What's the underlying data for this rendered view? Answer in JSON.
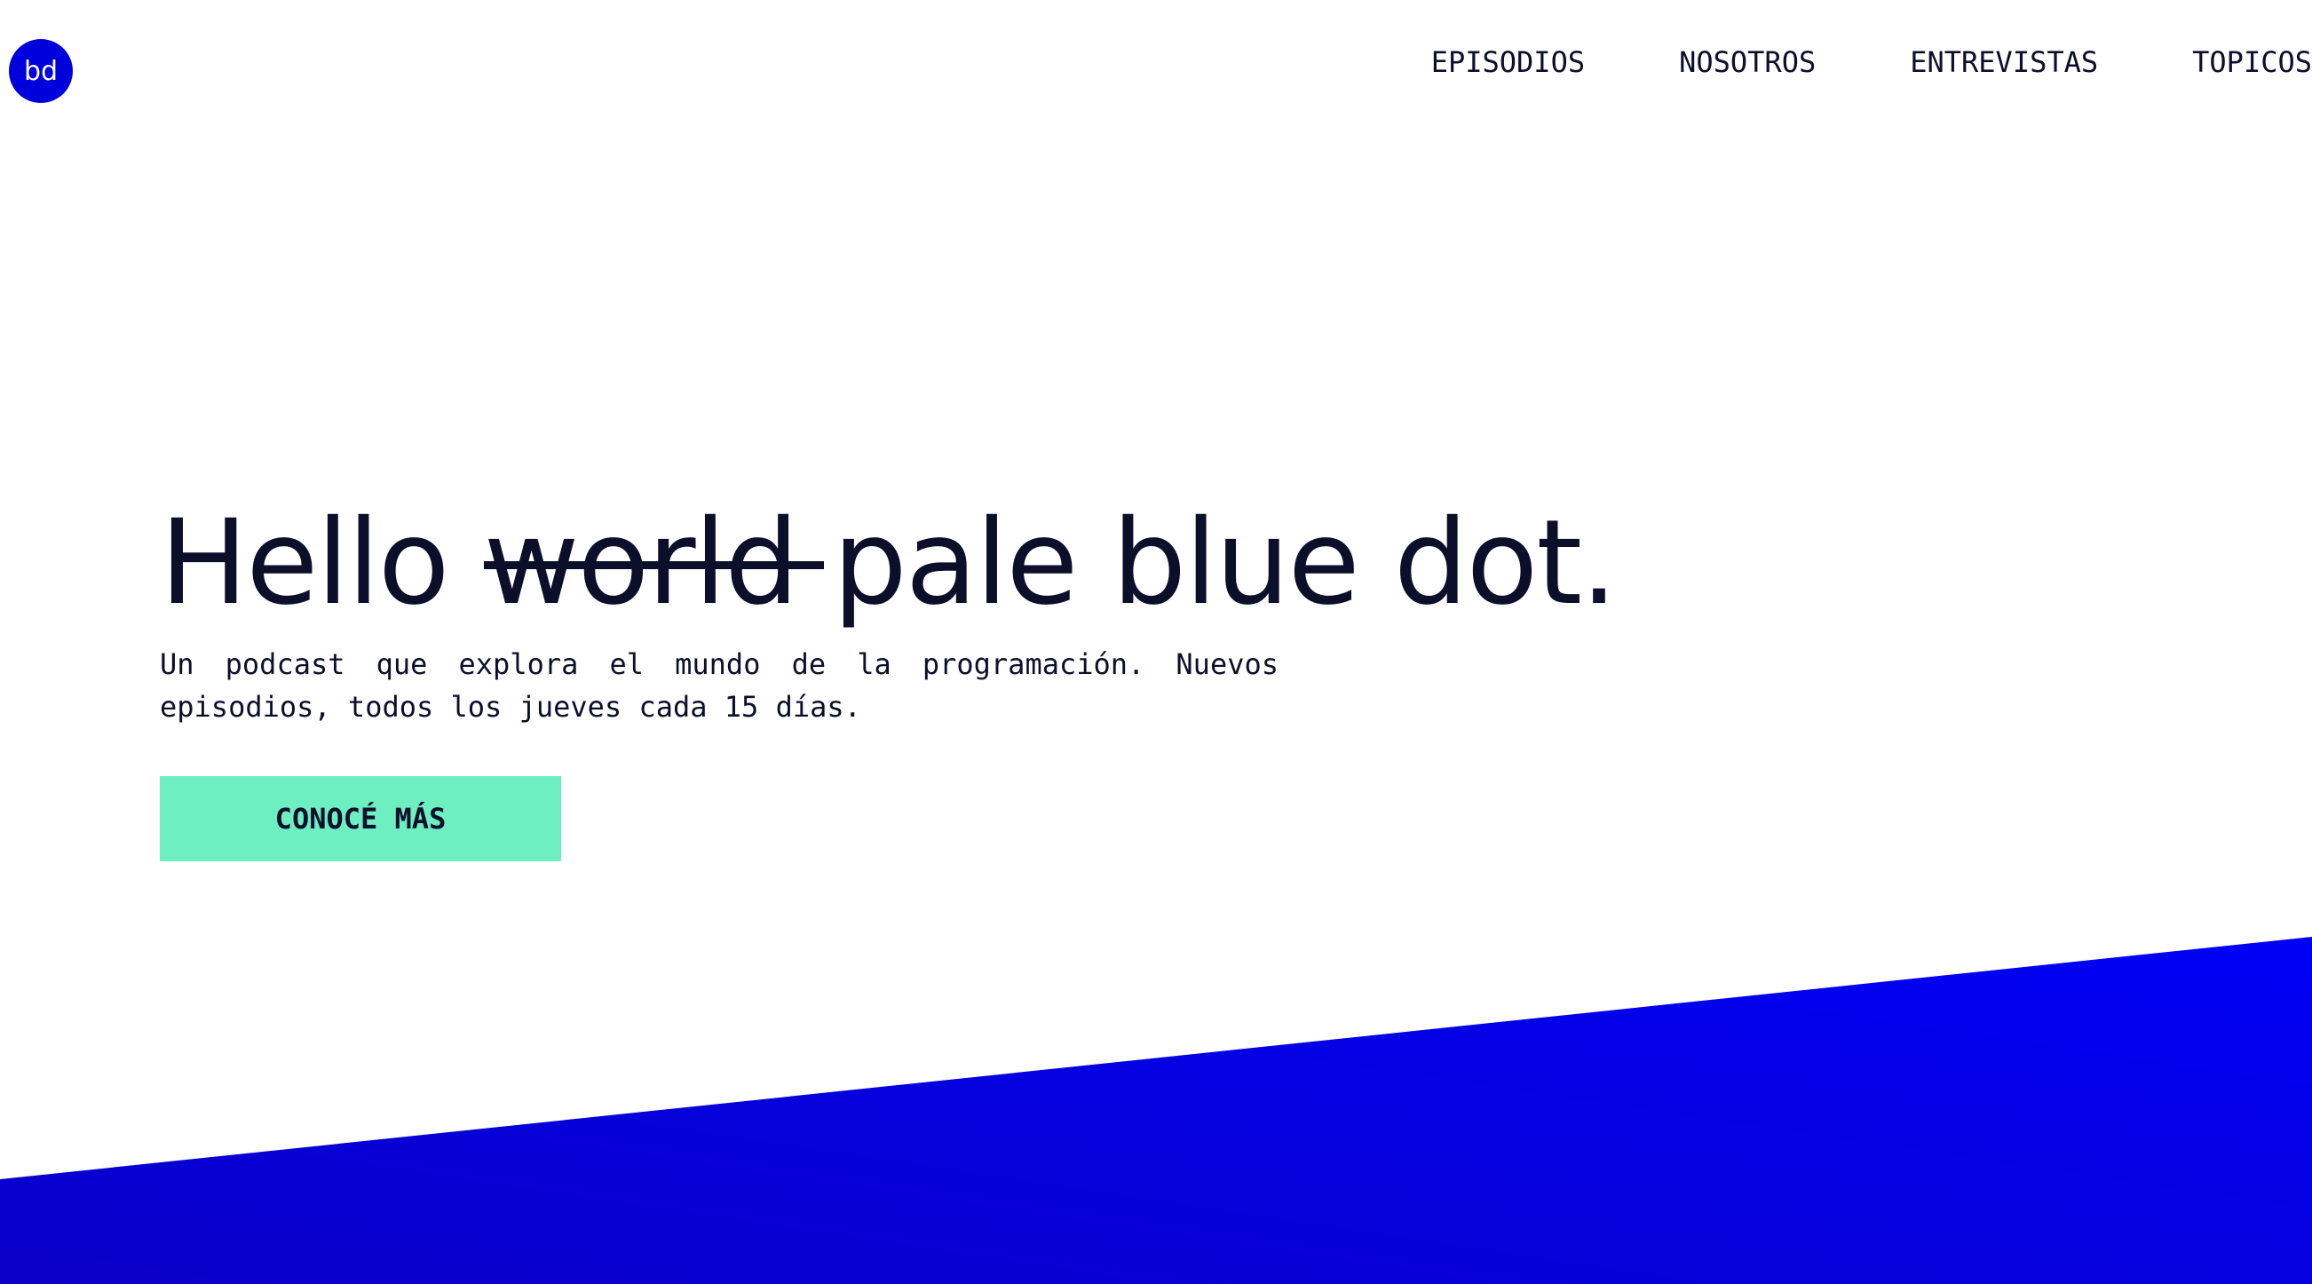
{
  "logo": {
    "text": "bd"
  },
  "nav": {
    "items": [
      {
        "label": "EPISODIOS"
      },
      {
        "label": "NOSOTROS"
      },
      {
        "label": "ENTREVISTAS"
      },
      {
        "label": "TOPICOS"
      }
    ]
  },
  "hero": {
    "title_prefix": "Hello ",
    "title_struck": "world",
    "title_suffix": " pale blue dot.",
    "description": "Un podcast que explora el mundo de la programación. Nuevos episodios, todos los jueves cada 15 días.",
    "cta_label": "CONOCÉ MÁS"
  },
  "colors": {
    "brand_blue": "#0000dd",
    "accent_green": "#6eefc2",
    "text_dark": "#0c0f2a",
    "band_gradient_start": "#0a00c8",
    "band_gradient_end": "#0000f5"
  }
}
